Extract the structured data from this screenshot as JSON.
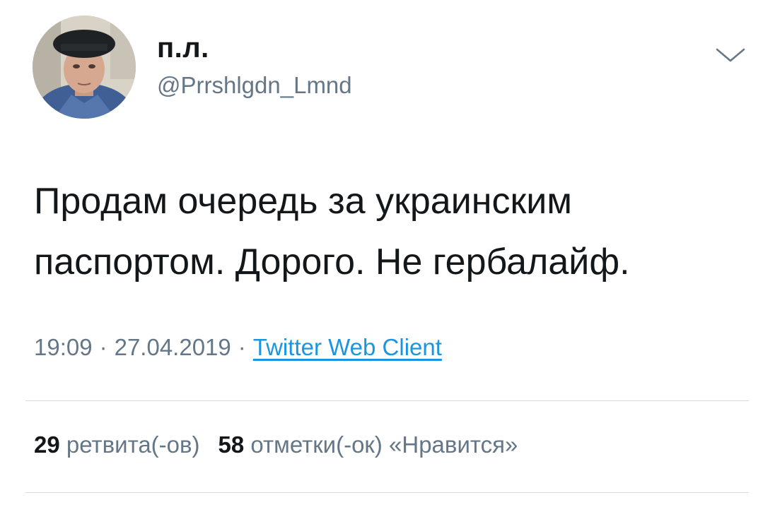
{
  "author": {
    "display_name": "п.л.",
    "handle": "@Prrshlgdn_Lmnd",
    "avatar_icon": "profile-photo"
  },
  "menu": {
    "icon": "chevron-down-icon"
  },
  "tweet": {
    "text_line1": "Продам очередь за украинским",
    "text_line2": "паспортом. Дорого. Не гербалайф."
  },
  "meta": {
    "time": "19:09",
    "separator": "·",
    "date": "27.04.2019",
    "client": "Twitter Web Client"
  },
  "stats": {
    "retweets_count": "29",
    "retweets_label": "ретвита(-ов)",
    "likes_count": "58",
    "likes_label": "отметки(-ок) «Нравится»"
  },
  "colors": {
    "text": "#14171a",
    "secondary": "#657786",
    "link": "#1b95e0",
    "divider": "#d3dbe2"
  }
}
